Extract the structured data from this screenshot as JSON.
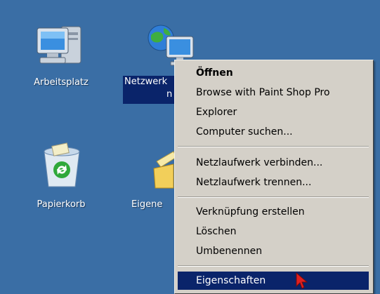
{
  "desktop": {
    "background": "#3a6ea5",
    "icons": [
      {
        "label": "Arbeitsplatz",
        "icon": "computer-icon"
      },
      {
        "label_line1": "Netzwerkumgebung",
        "label_line1_visible": "Netzwerk",
        "label_line2": "n",
        "icon": "network-places-icon",
        "selected": true
      },
      {
        "label": "Papierkorb",
        "icon": "recycle-bin-icon"
      },
      {
        "label_visible": "Eigene",
        "icon": "my-documents-icon"
      }
    ]
  },
  "context_menu": {
    "items": [
      {
        "label": "Öffnen",
        "bold": true
      },
      {
        "label": "Browse with Paint Shop Pro"
      },
      {
        "label": "Explorer"
      },
      {
        "label": "Computer suchen..."
      },
      {
        "label": "Netzlaufwerk verbinden..."
      },
      {
        "label": "Netzlaufwerk trennen..."
      },
      {
        "label": "Verknüpfung erstellen"
      },
      {
        "label": "Löschen"
      },
      {
        "label": "Umbenennen"
      },
      {
        "label": "Eigenschaften",
        "highlighted": true
      }
    ],
    "highlight_color": "#0a246a",
    "background": "#d4d0c8"
  },
  "cursor": {
    "icon": "mouse-pointer-icon",
    "color": "#e02020"
  }
}
